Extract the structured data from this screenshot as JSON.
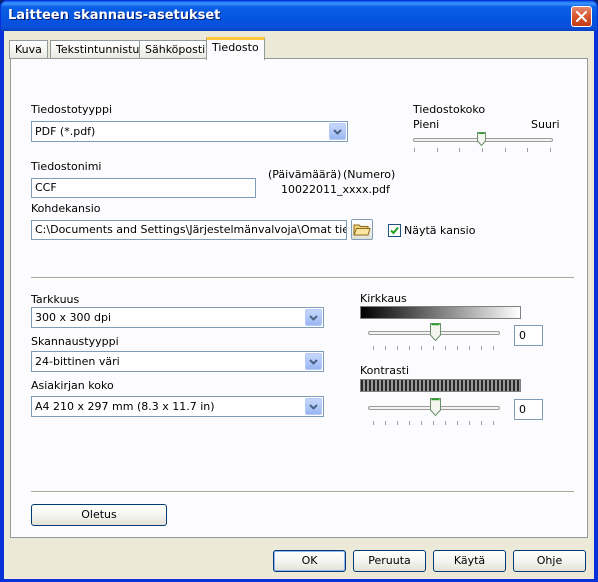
{
  "window": {
    "title": "Laitteen skannaus-asetukset"
  },
  "tabs": [
    {
      "label": "Kuva"
    },
    {
      "label": "Tekstintunnistus"
    },
    {
      "label": "Sähköposti"
    },
    {
      "label": "Tiedosto",
      "active": true
    }
  ],
  "file": {
    "type_label": "Tiedostotyyppi",
    "type_value": "PDF (*.pdf)",
    "size_label": "Tiedostokoko",
    "size_small": "Pieni",
    "size_large": "Suuri",
    "size_level": 0.45,
    "name_label": "Tiedostonimi",
    "name_value": "CCF",
    "date_hint": "(Päivämäärä)",
    "number_hint": "(Numero)",
    "example_name": "10022011_xxxx.pdf",
    "folder_label": "Kohdekansio",
    "folder_value": "C:\\Documents and Settings\\Järjestelmänvalvoja\\Omat tiedostot",
    "show_folder_label": "Näytä kansio",
    "show_folder_checked": true
  },
  "scan": {
    "resolution_label": "Tarkkuus",
    "resolution_value": "300 x 300 dpi",
    "type_label": "Skannaustyyppi",
    "type_value": "24-bittinen väri",
    "doc_size_label": "Asiakirjan koko",
    "doc_size_value": "A4 210 x 297 mm (8.3 x 11.7 in)",
    "brightness_label": "Kirkkaus",
    "brightness_value": "0",
    "contrast_label": "Kontrasti",
    "contrast_value": "0"
  },
  "buttons": {
    "default": "Oletus",
    "ok": "OK",
    "cancel": "Peruuta",
    "apply": "Käytä",
    "help": "Ohje"
  },
  "colors": {
    "title_bar": "#0554e1",
    "dialog_bg": "#ece9d8",
    "active_tab_highlight": "#ffc83c"
  }
}
